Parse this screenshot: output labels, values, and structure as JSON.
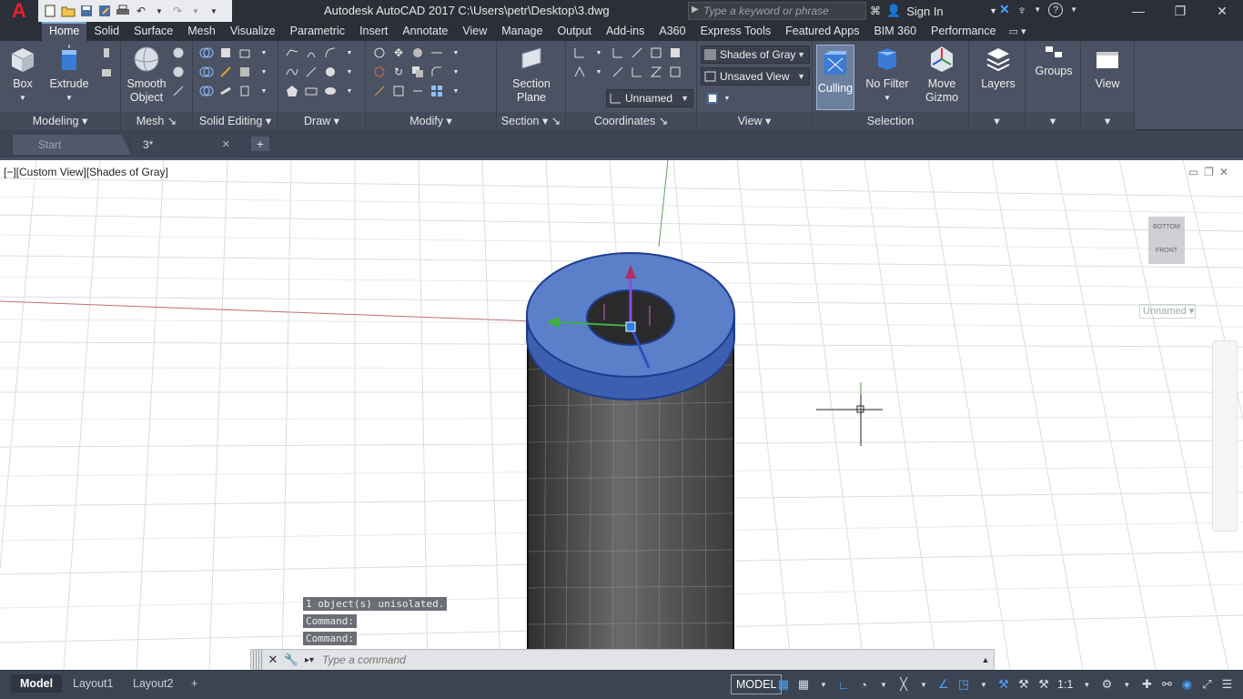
{
  "app": {
    "title": "Autodesk AutoCAD 2017    C:\\Users\\petr\\Desktop\\3.dwg",
    "logo_letter": "A",
    "search_placeholder": "Type a keyword or phrase",
    "sign_in": "Sign In"
  },
  "ribbon_tabs": [
    "Home",
    "Solid",
    "Surface",
    "Mesh",
    "Visualize",
    "Parametric",
    "Insert",
    "Annotate",
    "View",
    "Manage",
    "Output",
    "Add-ins",
    "A360",
    "Express Tools",
    "Featured Apps",
    "BIM 360",
    "Performance"
  ],
  "panels": {
    "modeling": "Modeling",
    "mesh": "Mesh",
    "solid_editing": "Solid Editing",
    "draw": "Draw",
    "modify": "Modify",
    "section": "Section",
    "coordinates": "Coordinates",
    "view": "View",
    "selection": "Selection"
  },
  "buttons": {
    "box": "Box",
    "extrude": "Extrude",
    "smooth_object_1": "Smooth",
    "smooth_object_2": "Object",
    "section_plane_1": "Section",
    "section_plane_2": "Plane",
    "culling": "Culling",
    "no_filter": "No Filter",
    "move_gizmo_1": "Move",
    "move_gizmo_2": "Gizmo",
    "layers": "Layers",
    "groups": "Groups",
    "view": "View"
  },
  "combos": {
    "visual_style": "Shades of Gray",
    "named_view": "Unsaved View",
    "ucs": "Unnamed"
  },
  "file_tabs": [
    "Start",
    "3*"
  ],
  "viewport": {
    "label": "[−][Custom View][Shades of Gray]",
    "viewcube_top": "BOTTOM",
    "viewcube_front": "FRONT",
    "ucs_label": "Unnamed"
  },
  "command": {
    "history": [
      "1 object(s) unisolated.",
      "Command:",
      "Command:"
    ],
    "placeholder": "Type a command"
  },
  "layout_tabs": [
    "Model",
    "Layout1",
    "Layout2"
  ],
  "status": {
    "model": "MODEL",
    "scale": "1:1"
  }
}
